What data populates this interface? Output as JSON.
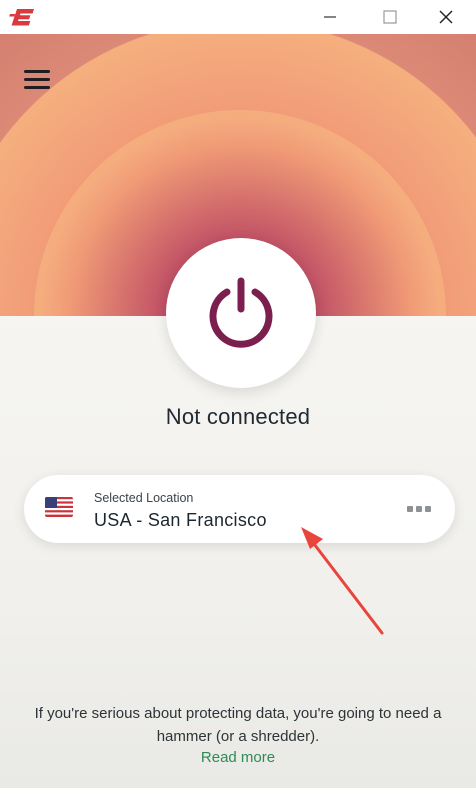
{
  "window": {
    "controls": [
      "minimize-icon",
      "maximize-icon",
      "close-icon"
    ]
  },
  "header": {
    "menu_icon": "hamburger-menu-icon"
  },
  "main": {
    "power_icon": "power-icon",
    "status_text": "Not connected"
  },
  "location": {
    "label": "Selected Location",
    "value": "USA - San Francisco",
    "flag_icon": "us-flag-icon",
    "more_icon": "more-options-icon"
  },
  "footer": {
    "tip": "If you're serious about protecting data, you're going to need a hammer (or a shredder).",
    "link": "Read more"
  },
  "colors": {
    "brand_red": "#da3940",
    "power_icon": "#7a1f4e",
    "link_green": "#2f8a57",
    "hero_ring": "#f3a878",
    "annotation_arrow": "#e8453c"
  }
}
